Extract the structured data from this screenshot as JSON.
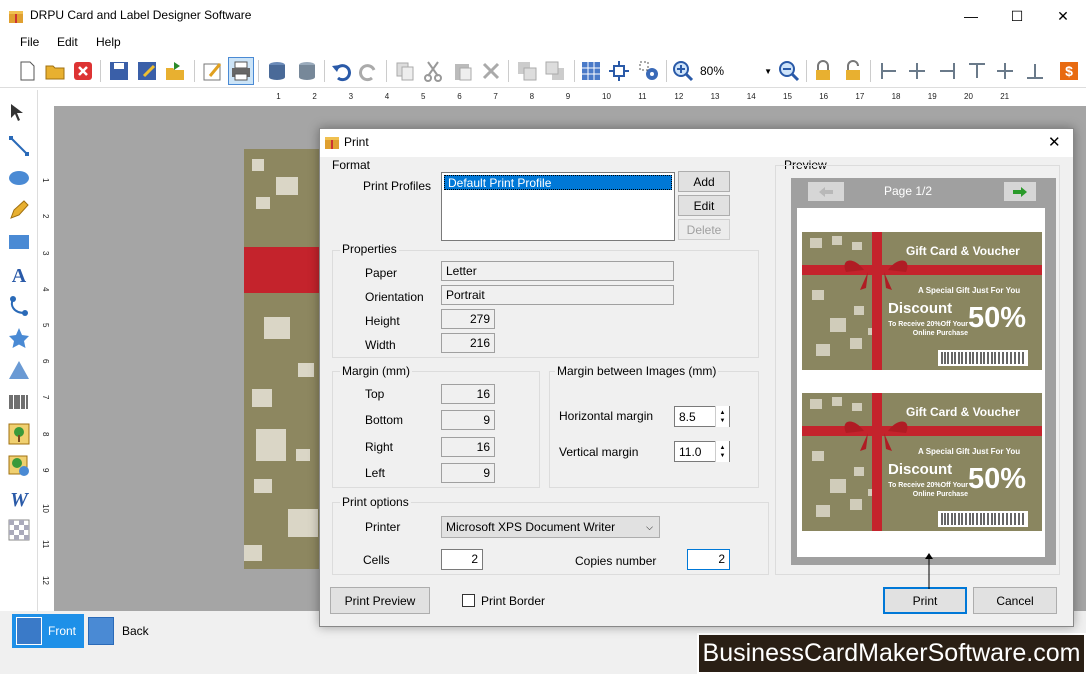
{
  "window": {
    "title": "DRPU Card and Label Designer Software",
    "controls": {
      "minimize": "—",
      "maximize": "☐",
      "close": "✕"
    }
  },
  "menu": [
    "File",
    "Edit",
    "Help"
  ],
  "toolbar": {
    "zoom_value": "80%",
    "icons": [
      "new-icon",
      "open-icon",
      "close-icon",
      "save-icon",
      "save-as-icon",
      "export-icon",
      "edit-icon",
      "print-icon",
      "database-import-icon",
      "database-icon",
      "undo-icon",
      "redo-icon",
      "copy-icon",
      "cut-icon",
      "paste-icon",
      "delete-icon",
      "bring-front-icon",
      "send-back-icon",
      "grid-icon",
      "fit-icon",
      "settings-icon",
      "zoom-in-icon",
      "zoom-out-icon",
      "lock-icon",
      "unlock-icon",
      "align-left-icon",
      "align-center-icon",
      "align-right-icon",
      "align-top-icon",
      "align-middle-icon",
      "align-bottom-icon",
      "price-icon"
    ]
  },
  "ruler": {
    "h_ticks": [
      "1",
      "2",
      "3",
      "4",
      "5",
      "6",
      "7",
      "8",
      "9",
      "10",
      "11",
      "12",
      "13",
      "14",
      "15",
      "16",
      "17",
      "18",
      "19",
      "20",
      "21"
    ],
    "v_ticks": [
      "1",
      "2",
      "3",
      "4",
      "5",
      "6",
      "7",
      "8",
      "9",
      "10",
      "11",
      "12"
    ]
  },
  "left_tools": [
    "select-icon",
    "line-icon",
    "ellipse-icon",
    "pencil-icon",
    "rectangle-icon",
    "text-icon",
    "arc-icon",
    "star-icon",
    "triangle-icon",
    "barcode-icon",
    "image-icon",
    "image-library-icon",
    "wordart-icon",
    "background-icon"
  ],
  "bottom_tabs": [
    {
      "label": "Front",
      "active": true
    },
    {
      "label": "Back",
      "active": false
    }
  ],
  "watermark": "BusinessCardMakerSoftware.com",
  "dialog": {
    "title": "Print",
    "format": {
      "group_label": "Format",
      "profiles_label": "Print Profiles",
      "profiles": [
        "Default Print Profile"
      ],
      "selected_profile": "Default Print Profile",
      "add": "Add",
      "edit": "Edit",
      "delete": "Delete"
    },
    "properties": {
      "group_label": "Properties",
      "paper_label": "Paper",
      "paper": "Letter",
      "orientation_label": "Orientation",
      "orientation": "Portrait",
      "height_label": "Height",
      "height": "279",
      "width_label": "Width",
      "width": "216"
    },
    "margin": {
      "group_label": "Margin (mm)",
      "top_label": "Top",
      "top": "16",
      "bottom_label": "Bottom",
      "bottom": "9",
      "right_label": "Right",
      "right": "16",
      "left_label": "Left",
      "left": "9"
    },
    "margin_between": {
      "group_label": "Margin between Images (mm)",
      "horizontal_label": "Horizontal margin",
      "horizontal": "8.5",
      "vertical_label": "Vertical margin",
      "vertical": "11.0"
    },
    "print_options": {
      "group_label": "Print options",
      "printer_label": "Printer",
      "printer": "Microsoft XPS Document Writer",
      "cells_label": "Cells",
      "cells": "2",
      "copies_label": "Copies number",
      "copies": "2"
    },
    "preview": {
      "group_label": "Preview",
      "page": "Page 1/2",
      "cards": [
        {
          "title": "Gift Card & Voucher",
          "subtitle": "A Special Gift Just For You",
          "discount": "Discount",
          "percent": "50%",
          "desc": "To Receive 20%Off Your Online Purchase"
        },
        {
          "title": "Gift Card & Voucher",
          "subtitle": "A Special Gift Just For You",
          "discount": "Discount",
          "percent": "50%",
          "desc": "To Receive 20%Off Your Online Purchase"
        }
      ]
    },
    "print_preview_button": "Print Preview",
    "print_border_label": "Print Border",
    "print_border_checked": false,
    "print_button": "Print",
    "cancel_button": "Cancel"
  }
}
